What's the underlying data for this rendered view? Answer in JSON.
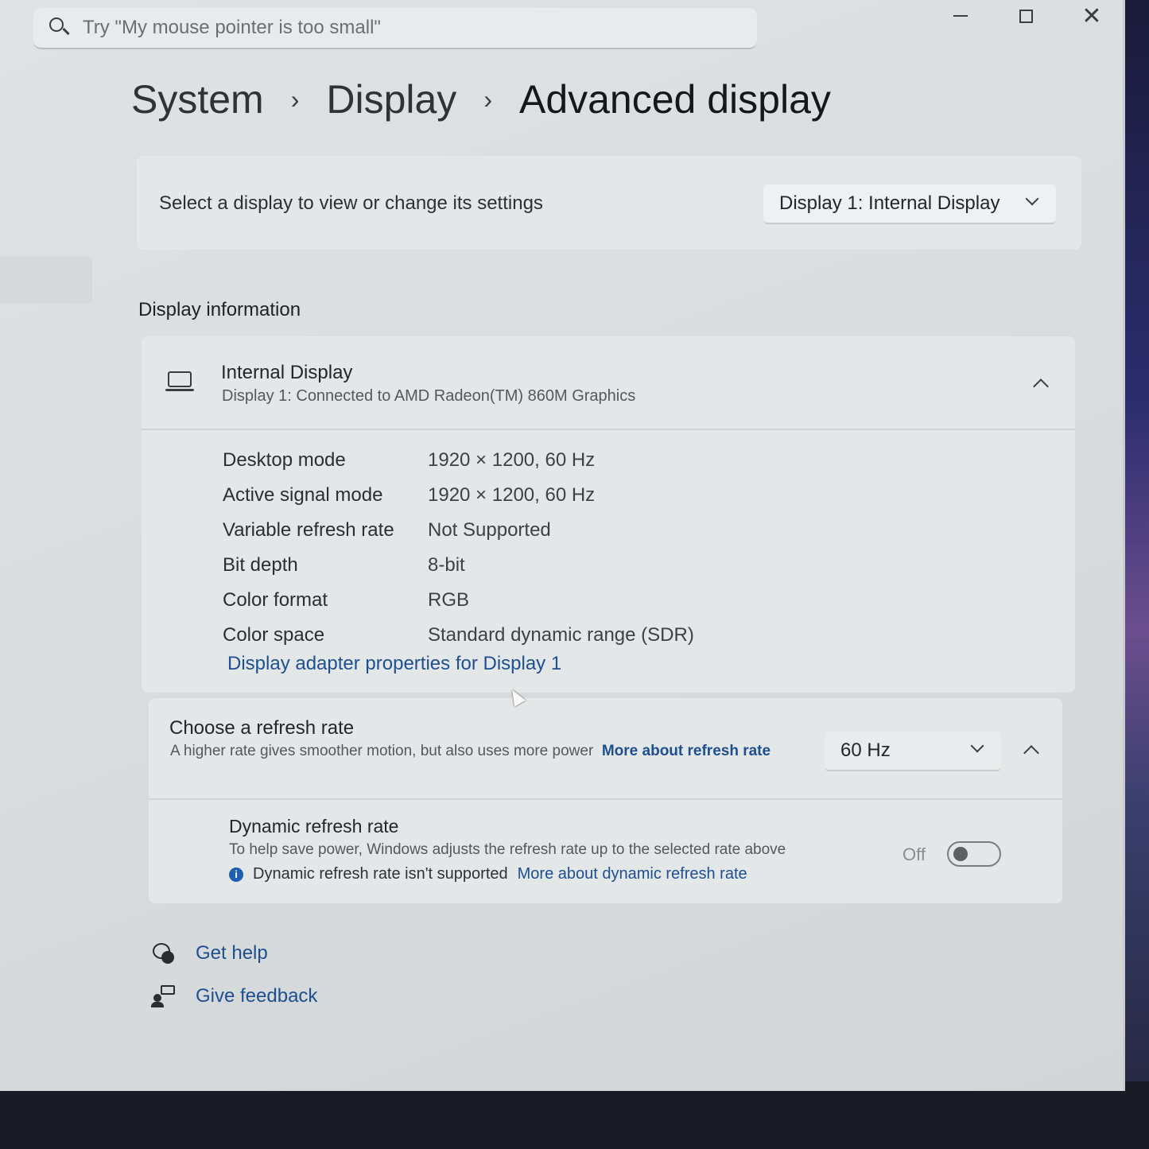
{
  "search": {
    "placeholder": "Try \"My mouse pointer is too small\""
  },
  "breadcrumb": {
    "items": [
      "System",
      "Display"
    ],
    "current": "Advanced display",
    "separator": "›"
  },
  "display_selector": {
    "label": "Select a display to view or change its settings",
    "selected": "Display 1: Internal Display"
  },
  "display_info": {
    "section_title": "Display information",
    "title": "Internal Display",
    "subtitle": "Display 1: Connected to AMD Radeon(TM) 860M Graphics",
    "rows": [
      {
        "key": "Desktop mode",
        "value": "1920 × 1200, 60 Hz"
      },
      {
        "key": "Active signal mode",
        "value": "1920 × 1200, 60 Hz"
      },
      {
        "key": "Variable refresh rate",
        "value": "Not Supported"
      },
      {
        "key": "Bit depth",
        "value": "8-bit"
      },
      {
        "key": "Color format",
        "value": "RGB"
      },
      {
        "key": "Color space",
        "value": "Standard dynamic range (SDR)"
      }
    ],
    "adapter_link": "Display adapter properties for Display 1"
  },
  "refresh_rate": {
    "title": "Choose a refresh rate",
    "description": "A higher rate gives smoother motion, but also uses more power",
    "link": "More about refresh rate",
    "selected": "60 Hz",
    "dynamic": {
      "title": "Dynamic refresh rate",
      "description": "To help save power, Windows adjusts the refresh rate up to the selected rate above",
      "note": "Dynamic refresh rate isn't supported",
      "note_link": "More about dynamic refresh rate",
      "toggle_label": "Off",
      "toggle_on": false
    }
  },
  "footer": {
    "help": "Get help",
    "feedback": "Give feedback"
  },
  "colors": {
    "accent": "#1d4f91",
    "info": "#1e5fb0"
  }
}
